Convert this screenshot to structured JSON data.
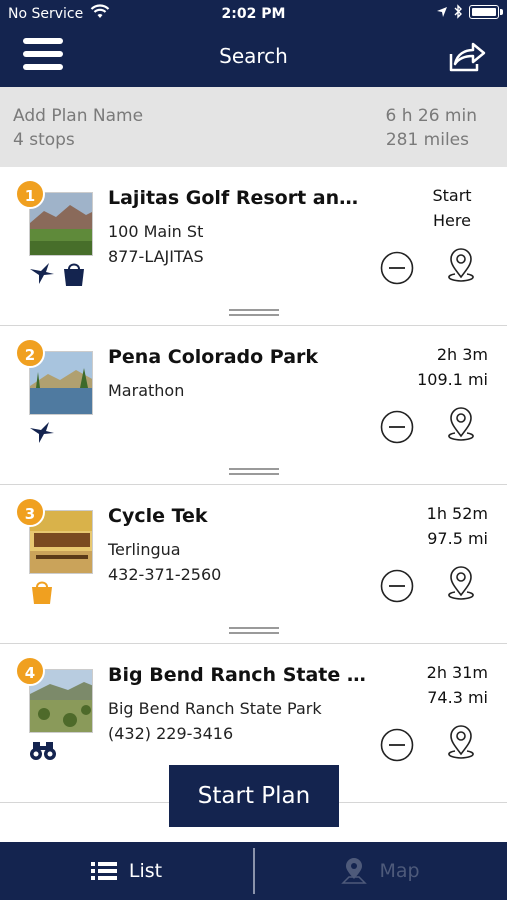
{
  "status_bar": {
    "carrier": "No Service",
    "time": "2:02 PM"
  },
  "nav": {
    "title": "Search"
  },
  "plan": {
    "name_placeholder": "Add Plan Name",
    "stops_count": "4 stops",
    "total_time": "6 h 26 min",
    "total_distance": "281 miles"
  },
  "stops": [
    {
      "number": "1",
      "name": "Lajitas Golf Resort and S...",
      "line1": "100 Main St",
      "line2": "877-LAJITAS",
      "eta_line1": "Start",
      "eta_line2": "Here",
      "category_icons": [
        "bird-icon",
        "shopping-bag-icon"
      ]
    },
    {
      "number": "2",
      "name": "Pena Colorado Park",
      "line1": "Marathon",
      "line2": "",
      "eta_line1": "2h 3m",
      "eta_line2": "109.1 mi",
      "category_icons": [
        "bird-icon"
      ]
    },
    {
      "number": "3",
      "name": "Cycle Tek",
      "line1": "Terlingua",
      "line2": "432-371-2560",
      "eta_line1": "1h 52m",
      "eta_line2": "97.5 mi",
      "category_icons": [
        "shopping-bag-icon"
      ]
    },
    {
      "number": "4",
      "name": "Big Bend Ranch State Park",
      "line1": "Big Bend Ranch State Park",
      "line2": "(432) 229-3416",
      "eta_line1": "2h 31m",
      "eta_line2": "74.3 mi",
      "category_icons": [
        "binoculars-icon"
      ]
    }
  ],
  "start_button": "Start Plan",
  "tabs": {
    "list": "List",
    "map": "Map"
  },
  "colors": {
    "navy": "#14244f",
    "badge_orange": "#f0a020",
    "plan_header_bg": "#e4e4e4"
  }
}
